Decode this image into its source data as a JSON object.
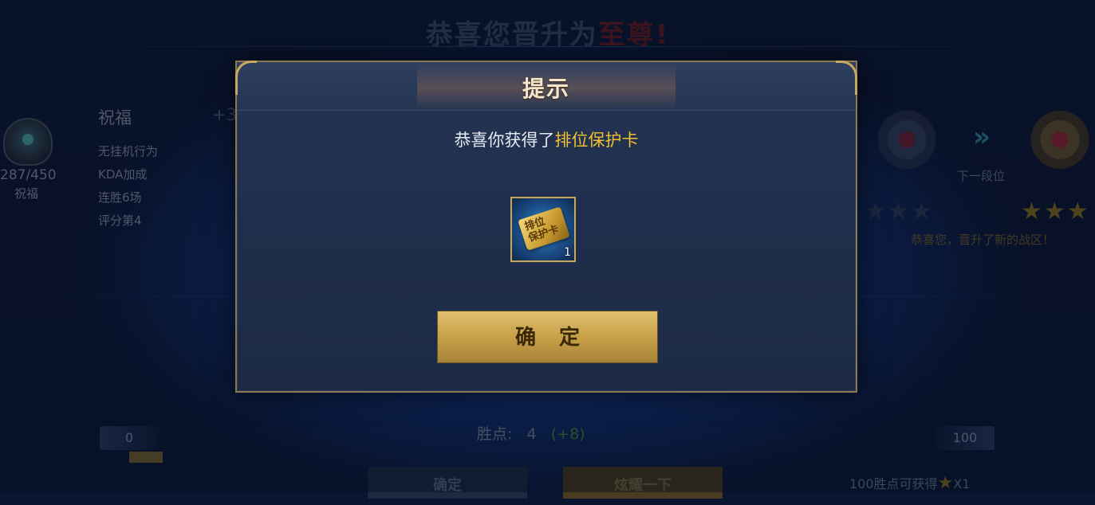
{
  "background": {
    "title_prefix": "恭喜您晋升为",
    "title_rank": "至尊!",
    "blessing_count": "287/450",
    "blessing_label": "祝福",
    "blessing_title": "祝福",
    "blessing_plus": "+3",
    "blessing_items": [
      "无挂机行为",
      "KDA加成",
      "连胜6场",
      "评分第4"
    ],
    "next_tier_label": "下一段位",
    "current_stars": "★★★",
    "next_stars": "★★★",
    "zone_message": "恭喜您，晋升了新的战区！",
    "points_min": "0",
    "points_max": "100",
    "win_points_label": "胜点:",
    "win_points_value": "4",
    "win_points_gain": "(+8)",
    "reward_text": "100胜点可获得",
    "reward_multiplier": "X1",
    "confirm_label": "确定",
    "show_off_label": "炫耀一下"
  },
  "modal": {
    "title": "提示",
    "message_prefix": "恭喜你获得了",
    "message_item": "排位保护卡",
    "item": {
      "card_text_line1": "排位",
      "card_text_line2": "保护卡",
      "count": "1",
      "icon": "rank-protection-card-icon"
    },
    "confirm_label": "确 定"
  },
  "colors": {
    "highlight": "#f0c030",
    "button_gold": "#c8a048",
    "modal_border": "#8a7850"
  }
}
